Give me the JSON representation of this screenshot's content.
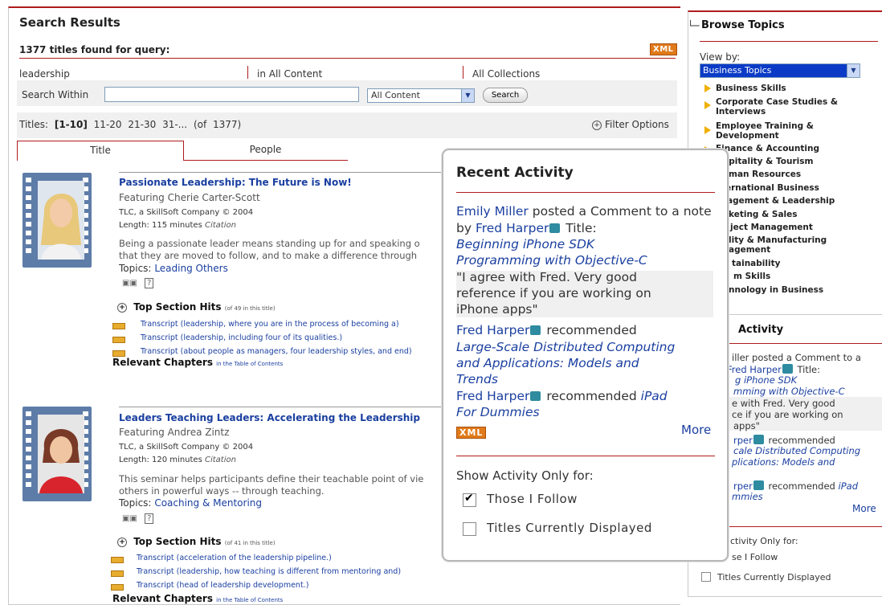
{
  "search": {
    "title": "Search Results",
    "found_text": "1377 titles found for query:",
    "xml_label": "XML",
    "query": "leadership",
    "scope": "in All Content",
    "collections": "All Collections",
    "within_label": "Search Within",
    "within_value": "",
    "content_select": "All Content",
    "search_button": "Search",
    "titles_prefix": "Titles:",
    "titles_current": "[1-10]",
    "titles_pages": [
      "11-20",
      "21-30",
      "31-..."
    ],
    "titles_total": "(of 1377)",
    "filter_options": "Filter Options",
    "tabs": [
      "Title",
      "People"
    ]
  },
  "results": [
    {
      "title": "Passionate Leadership: The Future is Now!",
      "featuring": "Featuring Cherie Carter-Scott",
      "publisher": "TLC, a SkillSoft Company © 2004",
      "length": "Length: 115 minutes",
      "citation": "Citation",
      "desc_line1": "Being a passionate leader means standing up for and speaking o",
      "desc_line2": "that they are moved to follow, and to make a difference through",
      "topics_label": "Topics:",
      "topic": "Leading Others",
      "tsh_label": "Top Section Hits",
      "tsh_count": "(of 49 in this title)",
      "transcripts": [
        "Transcript (leadership, where you are in the process of becoming a)",
        "Transcript (leadership, including four of its qualities.)",
        "Transcript (about people as managers, four leadership styles, and end)"
      ],
      "rel_label": "Relevant Chapters",
      "rel_link": "in the Table of Contents"
    },
    {
      "title": "Leaders Teaching Leaders: Accelerating the Leadership",
      "featuring": "Featuring Andrea Zintz",
      "publisher": "TLC, a SkillSoft Company © 2004",
      "length": "Length: 120 minutes",
      "citation": "Citation",
      "desc_line1": "This seminar helps participants define their teachable point of vie",
      "desc_line2": "others in powerful ways -- through teaching.",
      "topics_label": "Topics:",
      "topic": "Coaching & Mentoring",
      "tsh_label": "Top Section Hits",
      "tsh_count": "(of 41 in this title)",
      "transcripts": [
        "Transcript (acceleration of the leadership pipeline.)",
        "Transcript (leadership, how teaching is different from mentoring and)",
        "Transcript (head of leadership development.)"
      ],
      "rel_label": "Relevant Chapters",
      "rel_link": "in the Table of Contents"
    }
  ],
  "browse": {
    "title": "Browse Topics",
    "view_by": "View by:",
    "select_value": "Business Topics",
    "topics": [
      "Business Skills",
      "Corporate Case Studies & Interviews",
      "Employee Training & Development",
      "Finance & Accounting",
      "Hospitality & Tourism",
      "Human Resources",
      "International Business",
      "Management & Leadership",
      "Marketing & Sales",
      "Project Management",
      "Quality & Manufacturing Management",
      "Sustainability",
      "Team Skills",
      "Technology in Business"
    ],
    "topics_partial": [
      "spitality & Tourism",
      "man Resources",
      "ernational Business",
      "agement & Leadership",
      "keting & Sales",
      "ject Management",
      "lity & Manufacturing",
      "agement",
      "tainability",
      "m Skills",
      "nnology in Business"
    ]
  },
  "right_activity": {
    "title": "Activity",
    "lines": [
      "iller posted a Comment to a",
      "Fred Harper",
      "Title:",
      "g iPhone SDK",
      "mming with Objective-C",
      "e with Fred. Very good",
      "ce if you are working on",
      "apps\"",
      "rper",
      "recommended",
      "cale Distributed Computing",
      "plications: Models and",
      "rper",
      "recommended",
      "iPad",
      "mmies"
    ],
    "more": "More",
    "show_label": "ctivity Only for:",
    "follow": "se I Follow",
    "displayed": "Titles Currently Displayed"
  },
  "popup": {
    "title": "Recent Activity",
    "a1_user": "Emily Miller",
    "a1_text": "posted a Comment to a note by",
    "a1_user2": "Fred Harper",
    "a1_title_label": "Title:",
    "a1_book_l1": "Beginning iPhone SDK",
    "a1_book_l2": "Programming with Objective-C",
    "quote_l1": "\"I agree with Fred. Very good",
    "quote_l2": "reference if you are working on",
    "quote_l3": "iPhone apps\"",
    "a2_user": "Fred Harper",
    "a2_text": "recommended",
    "a2_book_l1": "Large-Scale Distributed Computing",
    "a2_book_l2": "and Applications: Models and",
    "a2_book_l3": "Trends",
    "a3_user": "Fred Harper",
    "a3_text": "recommended",
    "a3_book_l1": "iPad",
    "a3_book_l2": "For Dummies",
    "xml_label": "XML",
    "more": "More",
    "show_label": "Show Activity Only for:",
    "follow_label": "Those I Follow",
    "follow_checked": true,
    "displayed_label": "Titles Currently Displayed",
    "displayed_checked": false
  },
  "colors": {
    "accent_red": "#b01b1b",
    "link_blue": "#1a3fa0",
    "xml_orange": "#e07a1a",
    "topic_arrow": "#f0b000"
  },
  "icons": [
    "plus-circle-icon",
    "film-strip-icon",
    "browse-tree-icon",
    "dropdown-arrow-icon",
    "checkbox-icon",
    "user-icon",
    "transcript-bar-icon",
    "binoculars-icon",
    "help-icon"
  ]
}
